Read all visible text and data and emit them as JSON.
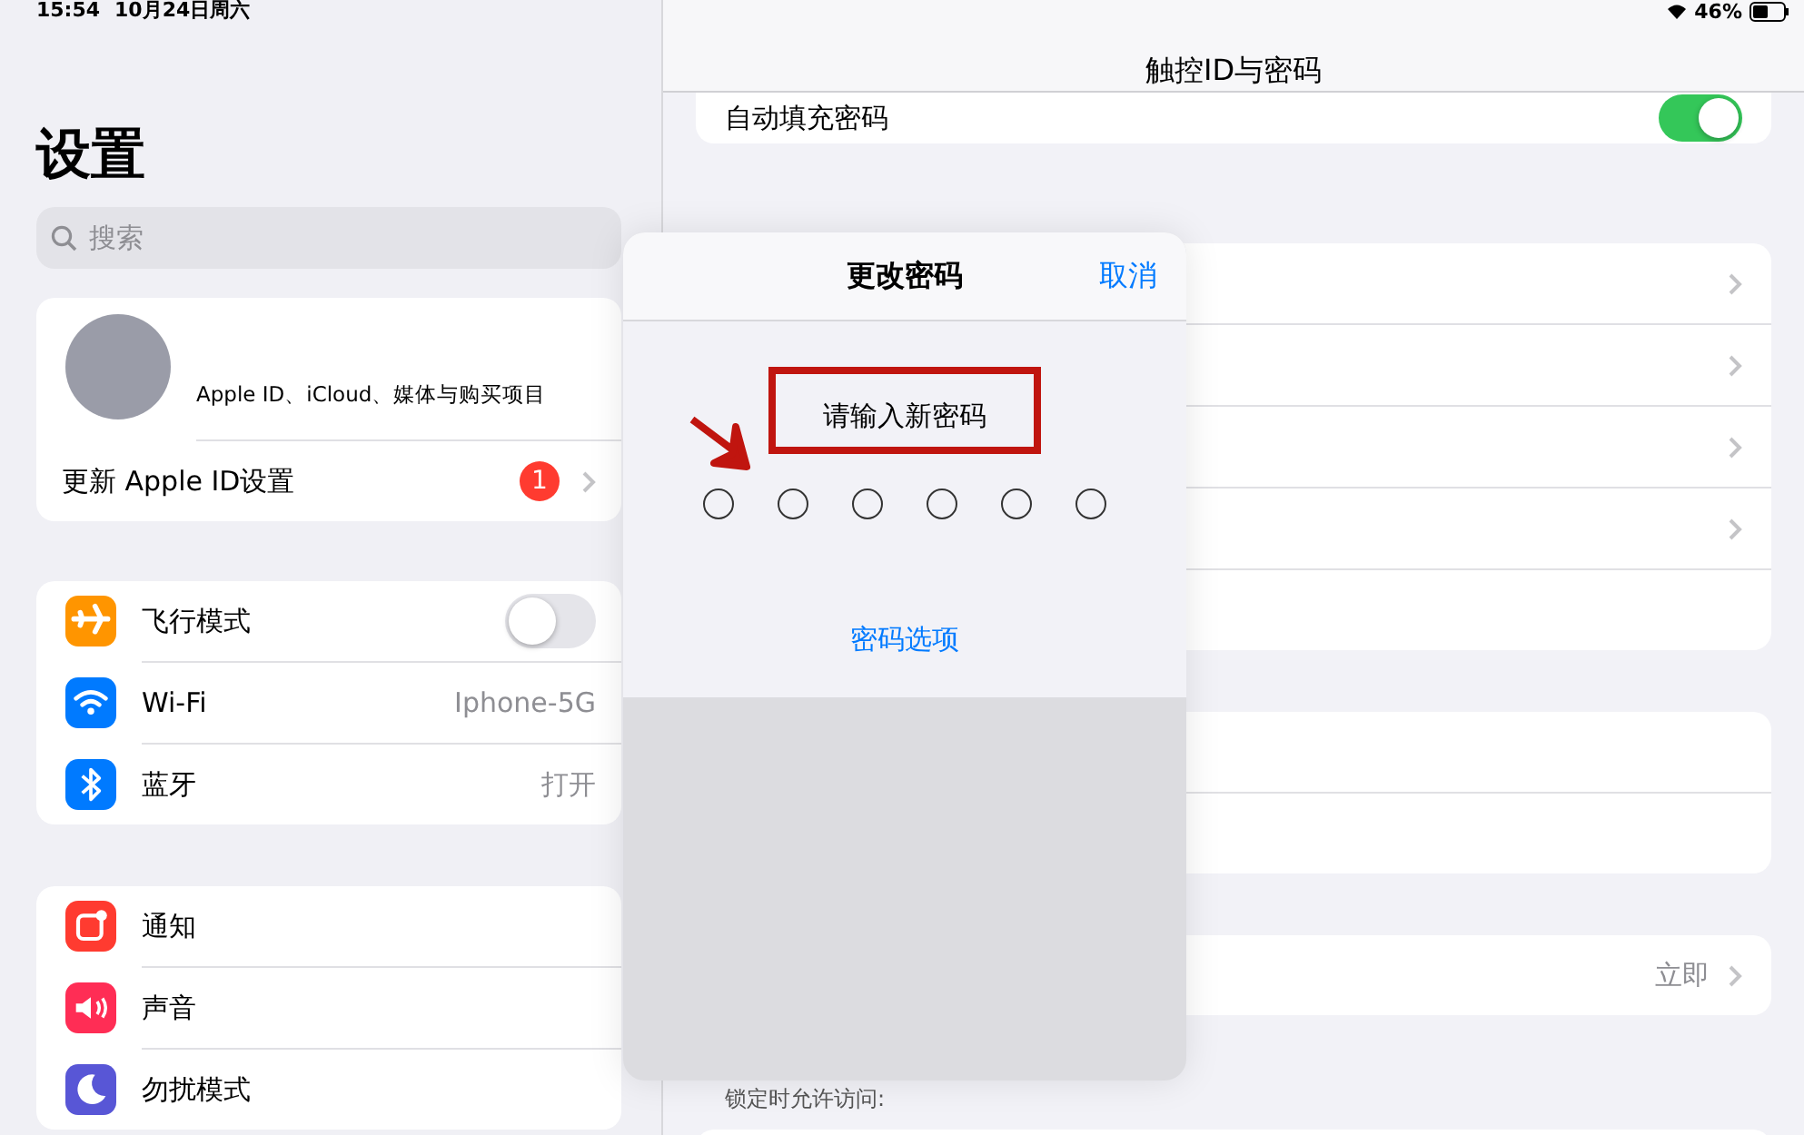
{
  "status_bar": {
    "time": "15:54",
    "date": "10月24日周六",
    "battery": "46%"
  },
  "sidebar": {
    "title": "设置",
    "search": {
      "placeholder": "搜索"
    },
    "account": {
      "subtitle": "Apple ID、iCloud、媒体与购买项目",
      "update_label": "更新 Apple ID设置",
      "badge": "1"
    },
    "groups": [
      [
        {
          "label": "飞行模式",
          "color": "#ff9500",
          "kind": "toggle",
          "on": false
        },
        {
          "label": "Wi-Fi",
          "color": "#007aff",
          "kind": "value",
          "value": "Iphone-5G"
        },
        {
          "label": "蓝牙",
          "color": "#007aff",
          "kind": "value",
          "value": "打开"
        }
      ],
      [
        {
          "label": "通知",
          "color": "#ff3b30",
          "kind": "plain"
        },
        {
          "label": "声音",
          "color": "#ff2d55",
          "kind": "plain"
        },
        {
          "label": "勿扰模式",
          "color": "#5856d6",
          "kind": "plain"
        }
      ]
    ]
  },
  "detail": {
    "title": "触控ID与密码",
    "autofill": {
      "label": "自动填充密码",
      "on": true
    },
    "groups": [
      {
        "rows": [
          {
            "chevron": true
          },
          {
            "chevron": true
          },
          {
            "chevron": true
          },
          {
            "chevron": true
          },
          {
            "chevron": false
          }
        ]
      },
      {
        "rows": [
          {
            "chevron": false
          },
          {
            "chevron": false
          }
        ]
      },
      {
        "rows": [
          {
            "value": "立即",
            "chevron": true
          }
        ]
      }
    ],
    "footer": "锁定时允许访问:"
  },
  "modal": {
    "title": "更改密码",
    "cancel": "取消",
    "prompt": "请输入新密码",
    "digits": [
      {
        "filled": false
      },
      {
        "filled": false
      },
      {
        "filled": false
      },
      {
        "filled": false
      },
      {
        "filled": false
      },
      {
        "filled": false
      }
    ],
    "options_link": "密码选项"
  }
}
